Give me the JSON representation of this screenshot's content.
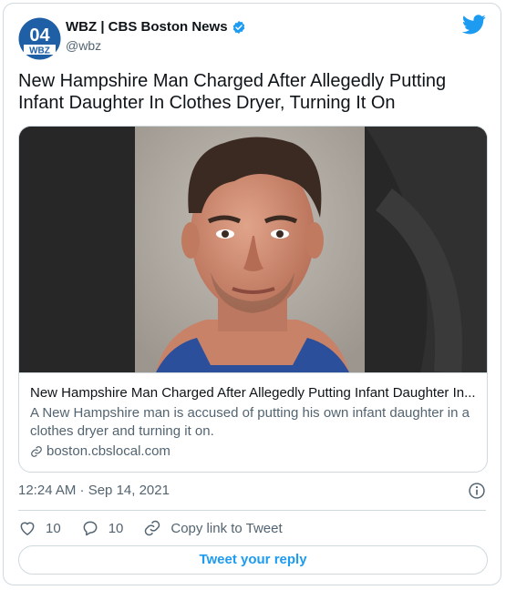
{
  "account": {
    "display_name": "WBZ | CBS Boston News",
    "handle": "@wbz",
    "logo_text_top": "04",
    "logo_text_bottom": "WBZ"
  },
  "tweet": {
    "text": "New Hampshire Man Charged After Allegedly Putting Infant Daughter In Clothes Dryer, Turning It On",
    "timestamp": "12:24 AM · Sep 14, 2021"
  },
  "link_card": {
    "title": "New Hampshire Man Charged After Allegedly Putting Infant Daughter In...",
    "description": "A New Hampshire man is accused of putting his own infant daughter in a clothes dryer and turning it on.",
    "domain": "boston.cbslocal.com"
  },
  "actions": {
    "like_count": "10",
    "reply_count": "10",
    "copy_link_label": "Copy link to Tweet"
  },
  "reply_button_label": "Tweet your reply",
  "colors": {
    "accent": "#1d9bf0",
    "secondary_text": "#536471",
    "border": "#cfd9de",
    "logo_blue": "#1f5fa6"
  },
  "icons": [
    "verified-badge-icon",
    "twitter-bird-icon",
    "info-icon",
    "heart-icon",
    "reply-bubble-icon",
    "link-icon"
  ]
}
